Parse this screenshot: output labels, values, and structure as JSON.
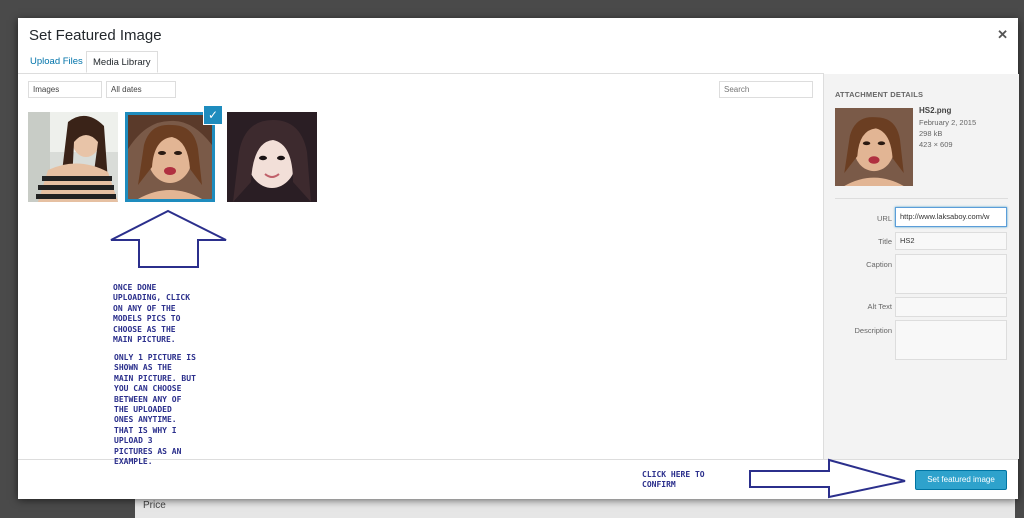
{
  "modal": {
    "title": "Set Featured Image",
    "close_icon": "close-icon",
    "tabs": [
      {
        "label": "Upload Files",
        "active": false
      },
      {
        "label": "Media Library",
        "active": true
      }
    ],
    "filters": {
      "type": "Images",
      "date": "All dates",
      "search_placeholder": "Search"
    },
    "media_items": [
      {
        "name": "photo-1",
        "selected": false
      },
      {
        "name": "photo-2",
        "selected": true
      },
      {
        "name": "photo-3",
        "selected": false
      }
    ],
    "check_icon": "checkmark-icon"
  },
  "attachment_details": {
    "heading": "ATTACHMENT DETAILS",
    "filename": "HS2.png",
    "date": "February 2, 2015",
    "size": "298 kB",
    "dimensions": "423 × 609",
    "fields": {
      "url_label": "URL",
      "url_value": "http://www.laksaboy.com/w",
      "title_label": "Title",
      "title_value": "HS2",
      "caption_label": "Caption",
      "caption_value": "",
      "alt_label": "Alt Text",
      "alt_value": "",
      "description_label": "Description",
      "description_value": ""
    }
  },
  "toolbar": {
    "primary_label": "Set featured image"
  },
  "annotations": {
    "note_1": "ONCE DONE\nUPLOADING, CLICK\nON ANY OF THE\nMODELS PICS TO\nCHOOSE AS THE\nMAIN PICTURE.",
    "note_2": "ONLY 1 PICTURE IS\nSHOWN AS THE\nMAIN PICTURE. BUT\nYOU CAN CHOOSE\nBETWEEN ANY OF\nTHE UPLOADED\nONES ANYTIME.\nTHAT IS WHY I\nUPLOAD 3\nPICTURES AS AN\nEXAMPLE.",
    "note_3": "CLICK HERE TO\nCONFIRM",
    "colors": {
      "ink": "#2b2f8c"
    }
  },
  "backdrop": {
    "label": "Price"
  },
  "colors": {
    "accent": "#2ea2cc",
    "selection": "#1e8cbe"
  }
}
